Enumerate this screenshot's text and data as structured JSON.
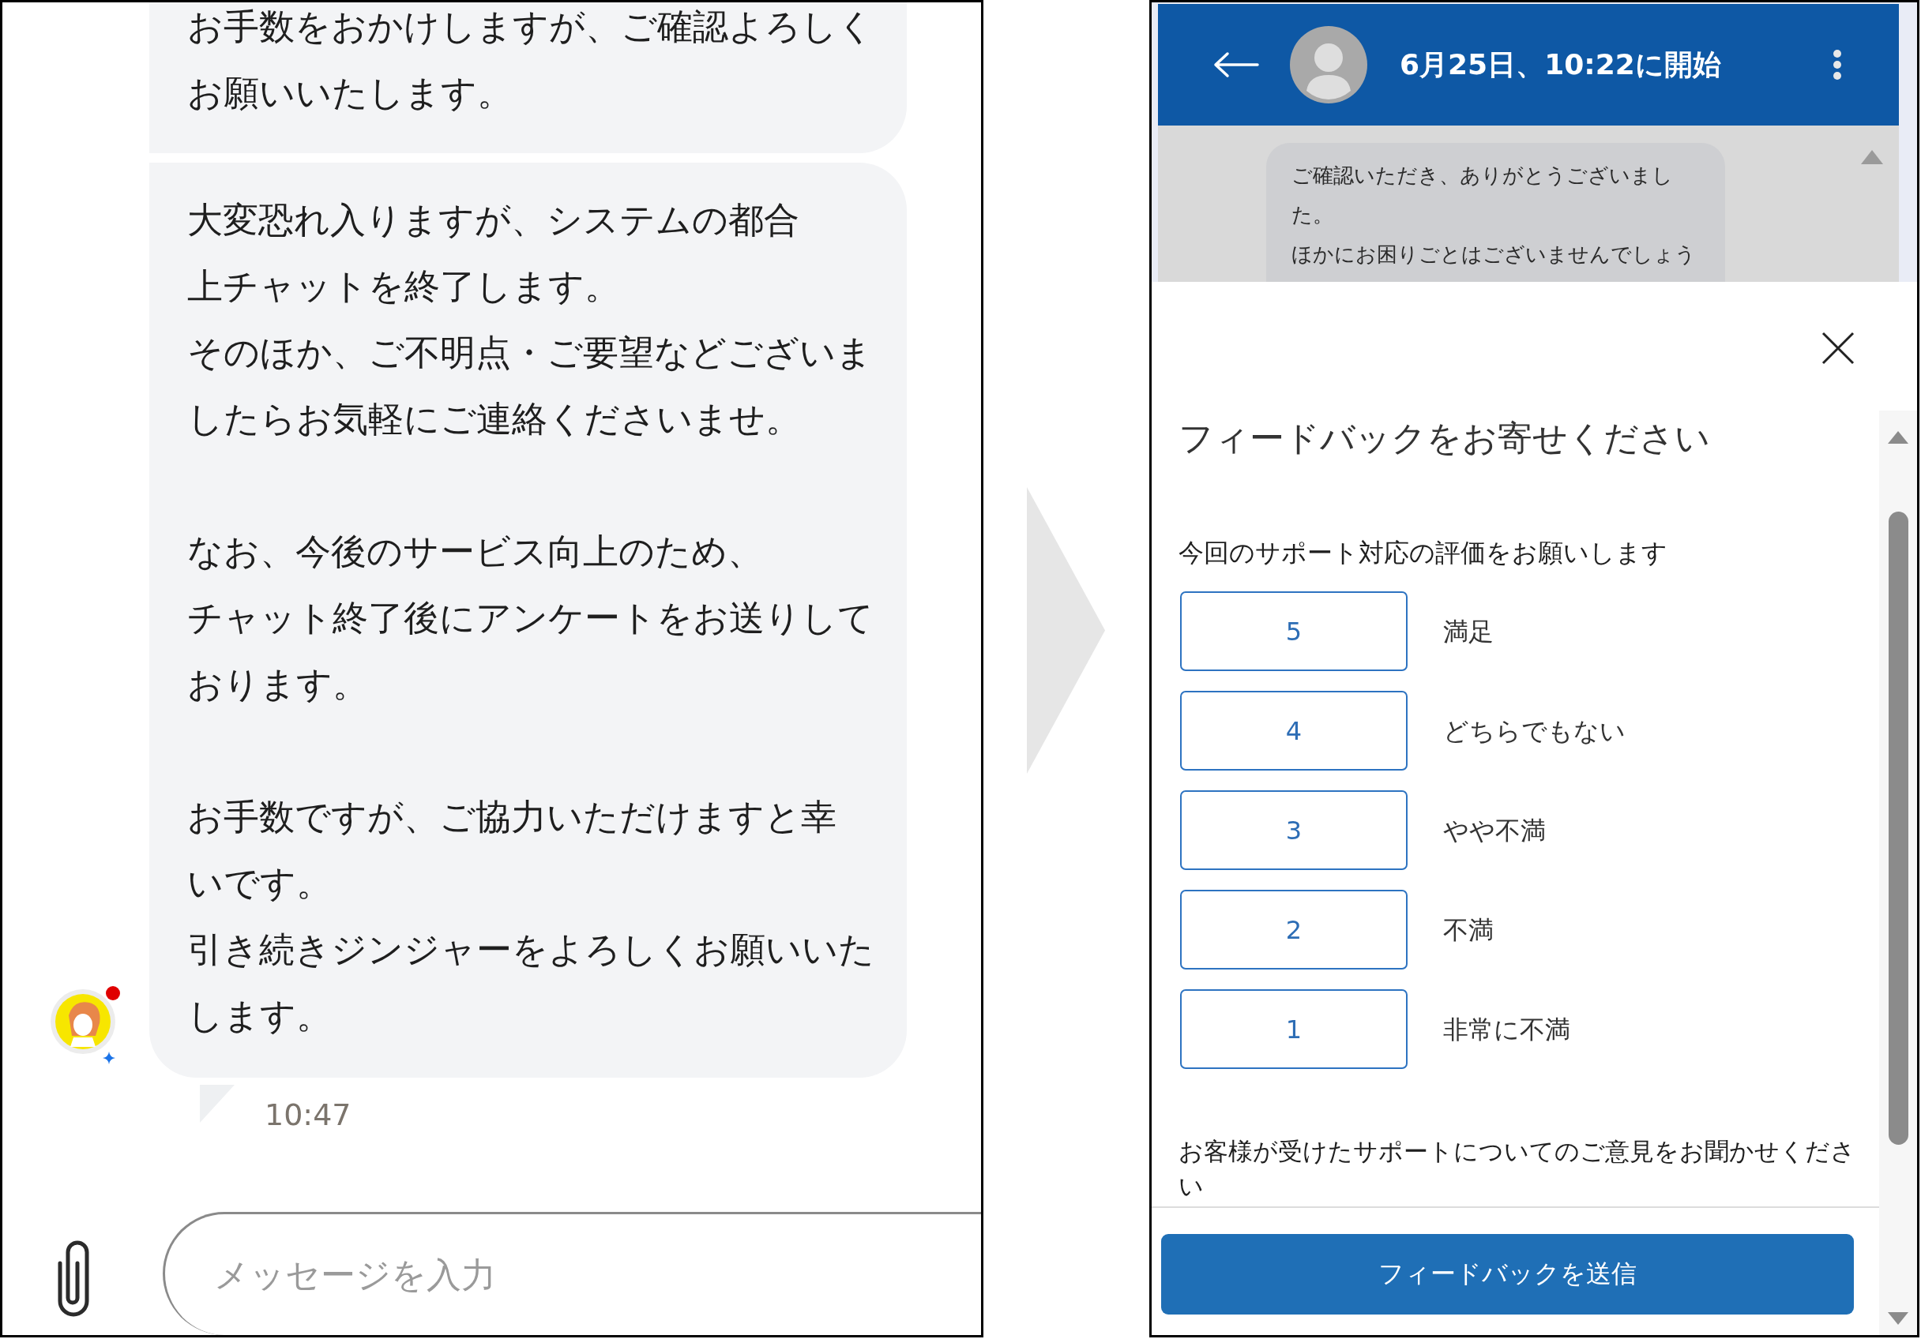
{
  "chat_view": {
    "messages": [
      {
        "paragraphs": [
          {
            "lines": [
              "お手数をおかけしますが、ご確認よろしく",
              "お願いいたします。"
            ]
          }
        ],
        "avatar": false,
        "notification_dot": false
      },
      {
        "paragraphs": [
          {
            "lines": [
              "大変恐れ入りますが、システムの都合",
              "上チャットを終了します。",
              "そのほか、ご不明点・ご要望などございま",
              "したらお気軽にご連絡くださいませ。"
            ]
          },
          {
            "lines": [
              "なお、今後のサービス向上のため、",
              "チャット終了後にアンケートをお送りして",
              "おります。"
            ]
          },
          {
            "lines": [
              "お手数ですが、ご協力いただけますと幸",
              "いです。",
              "引き続きジンジャーをよろしくお願いいた",
              "します。"
            ]
          }
        ],
        "avatar": true,
        "notification_dot": true
      }
    ],
    "timestamp": "10:47",
    "message_input": {
      "placeholder": "メッセージを入力"
    }
  },
  "feedback_view": {
    "header": {
      "title": "6月25日、10:22に開始"
    },
    "background_message": {
      "lines": [
        "ご確認いただき、ありがとうございまし",
        "た。",
        "ほかにお困りごとはございませんでしょう"
      ]
    },
    "feedback_form": {
      "title": "フィードバックをお寄せください",
      "rating_prompt": "今回のサポート対応の評価をお願いします",
      "ratings": [
        {
          "value": "5",
          "label": "満足",
          "selected": false
        },
        {
          "value": "4",
          "label": "どちらでもない",
          "selected": false
        },
        {
          "value": "3",
          "label": "やや不満",
          "selected": false
        },
        {
          "value": "2",
          "label": "不満",
          "selected": false
        },
        {
          "value": "1",
          "label": "非常に不満",
          "selected": false
        }
      ],
      "comment_prompt": "お客様が受けたサポートについてのご意見をお聞かせください",
      "submit_button": "フィードバックを送信"
    }
  }
}
